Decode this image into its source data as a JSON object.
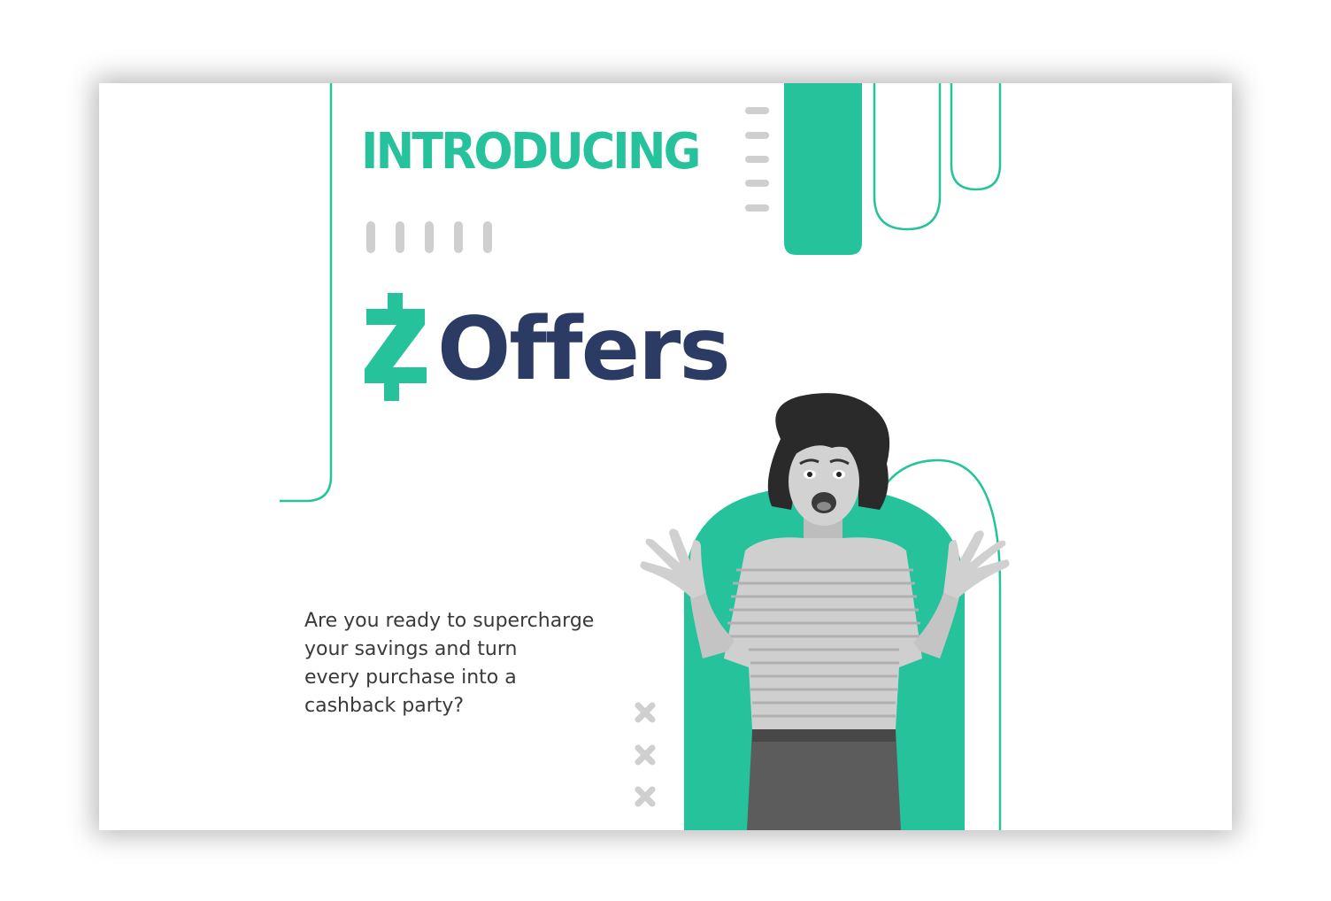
{
  "slide": {
    "heading": "INTRODUCING",
    "brand": {
      "mark_icon": "z-currency-logo-icon",
      "word": "Offers"
    },
    "tagline_lines": [
      "Are you ready to supercharge",
      "your savings and turn",
      "every purchase into a",
      "cashback party?"
    ],
    "photo_icon": "excited-woman-photo"
  },
  "colors": {
    "accent_green": "#25c29b",
    "brand_navy": "#2b3b63",
    "decor_gray": "#c8c8c8",
    "text_dark": "#3a3a3a"
  }
}
